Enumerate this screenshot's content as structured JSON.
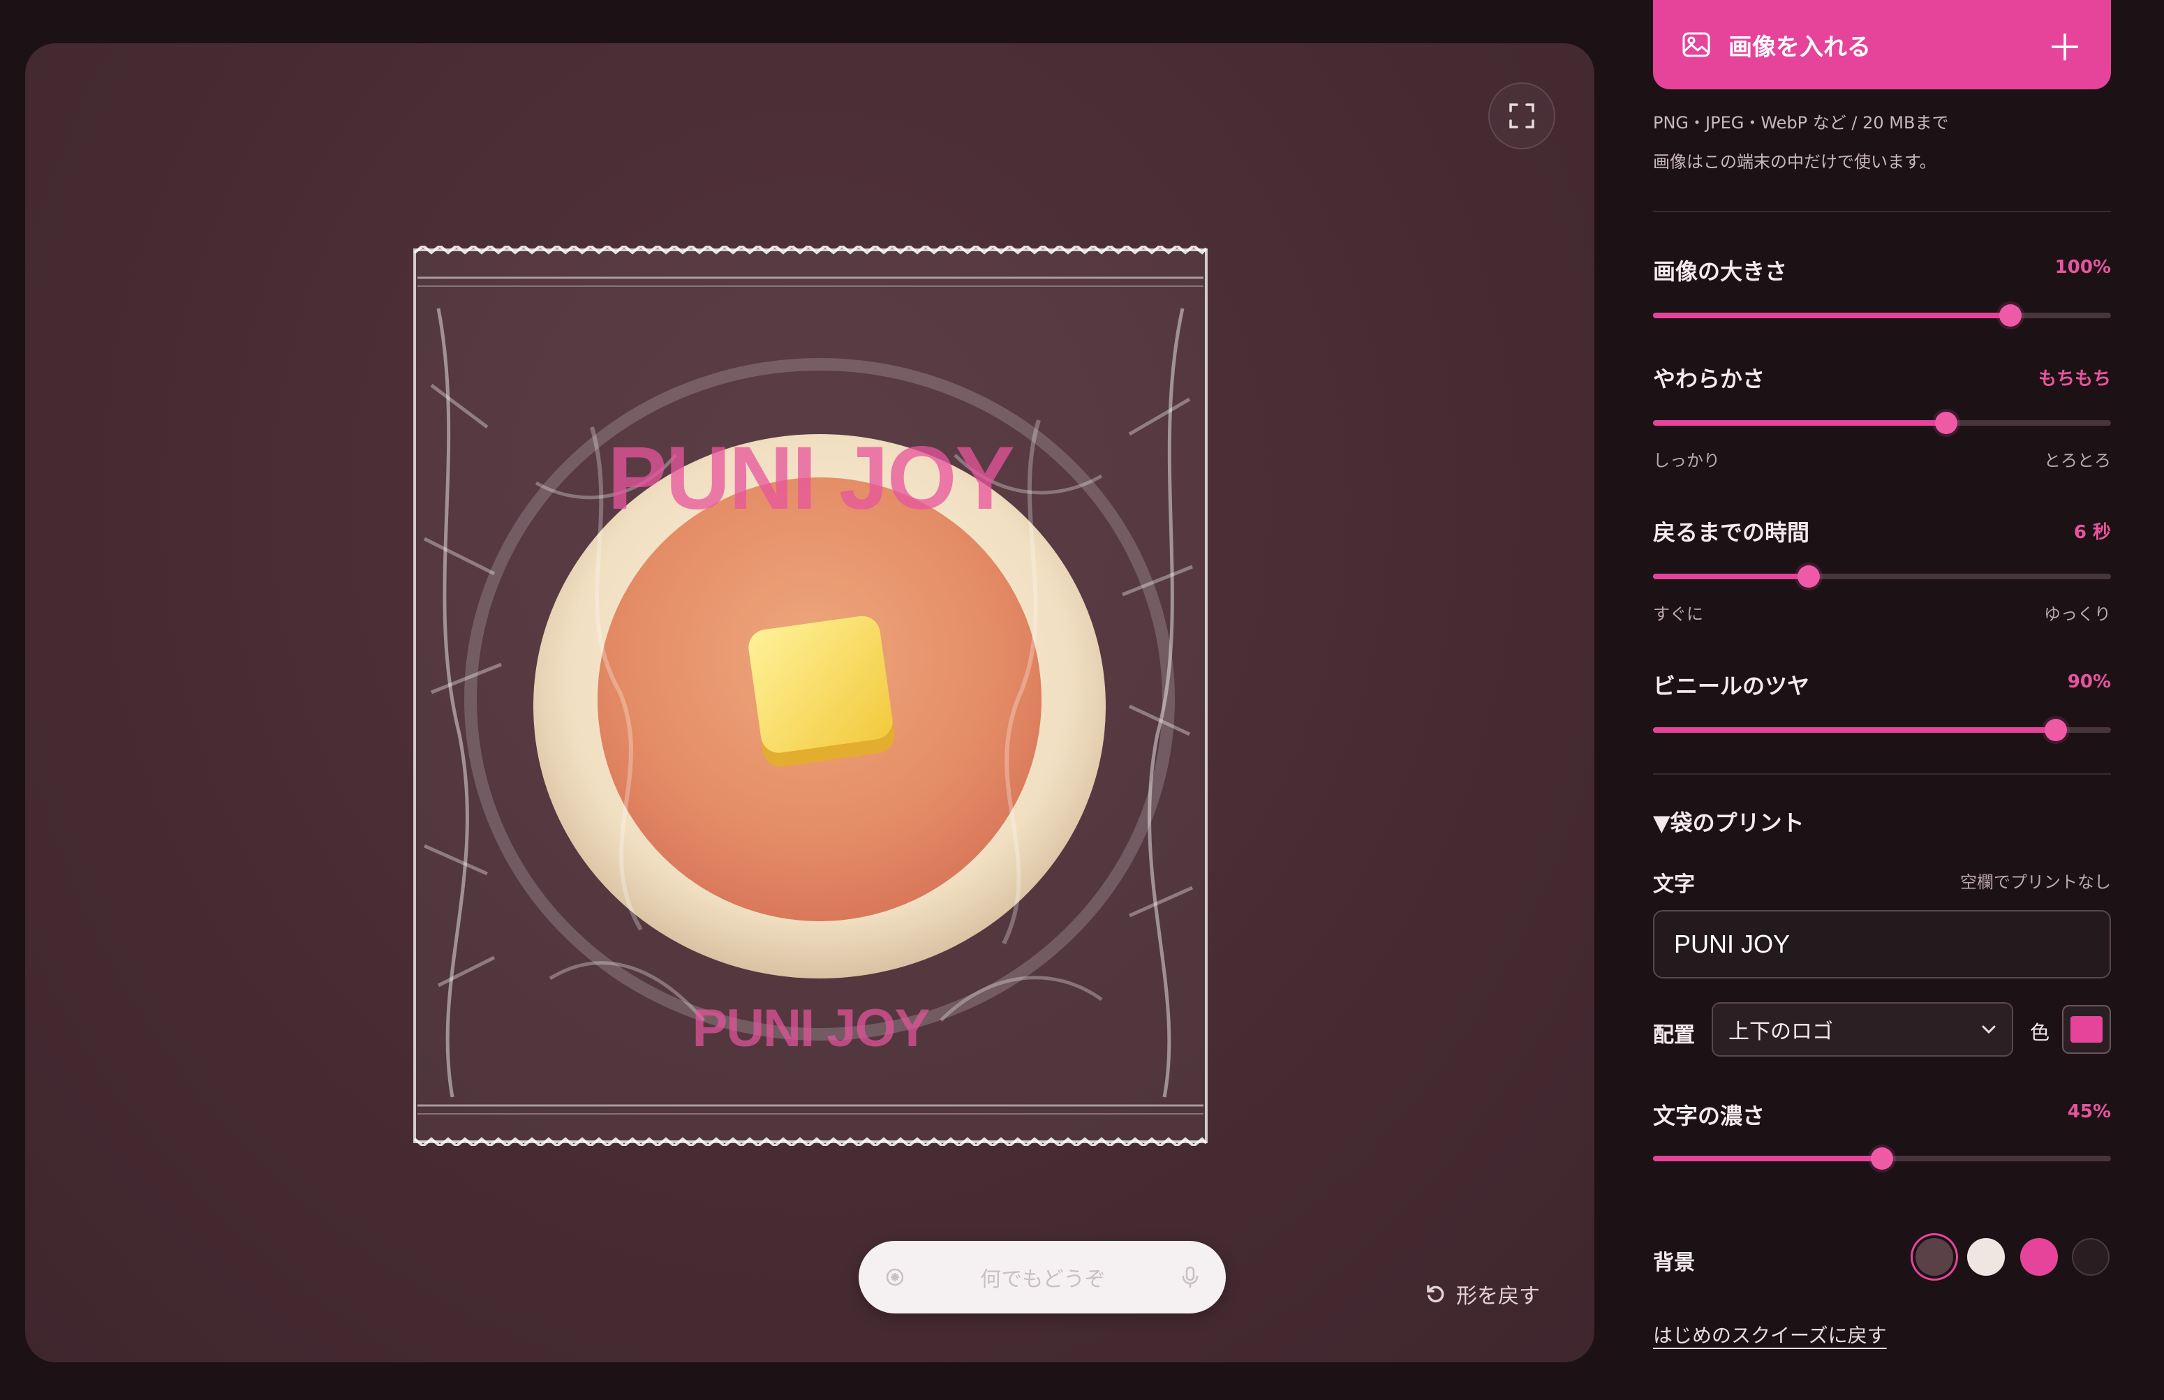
{
  "stage": {
    "print_text_top": "PUNI JOY",
    "print_text_bottom": "PUNI JOY",
    "reset_shape_label": "形を戻す",
    "prompt_placeholder": "何でもどうぞ"
  },
  "panel": {
    "upload_label": "画像を入れる",
    "hint_formats": "PNG・JPEG・WebP など / 20 MBまで",
    "hint_privacy": "画像はこの端末の中だけで使います。",
    "image_size": {
      "label": "画像の大きさ",
      "value": "100%",
      "level": 0.78
    },
    "softness": {
      "label": "やわらかさ",
      "value": "もちもち",
      "level": 0.64,
      "min_label": "しっかり",
      "max_label": "とろとろ"
    },
    "return_time": {
      "label": "戻るまでの時間",
      "value": "6 秒",
      "level": 0.34,
      "min_label": "すぐに",
      "max_label": "ゆっくり"
    },
    "vinyl_gloss": {
      "label": "ビニールのツヤ",
      "value": "90%",
      "level": 0.88
    },
    "bag_print": {
      "section_label": "▼袋のプリント",
      "text_label": "文字",
      "text_hint": "空欄でプリントなし",
      "text_value": "PUNI JOY",
      "layout_label": "配置",
      "layout_value": "上下のロゴ",
      "color_label": "色",
      "color_value": "#e6449b"
    },
    "text_density": {
      "label": "文字の濃さ",
      "value": "45%",
      "level": 0.5
    },
    "background": {
      "label": "背景",
      "options": [
        "#5a4148",
        "#efe6e2",
        "#e6449b",
        "#2a1d22"
      ],
      "selected": 0
    },
    "reset_link": "はじめのスクイーズに戻す"
  }
}
